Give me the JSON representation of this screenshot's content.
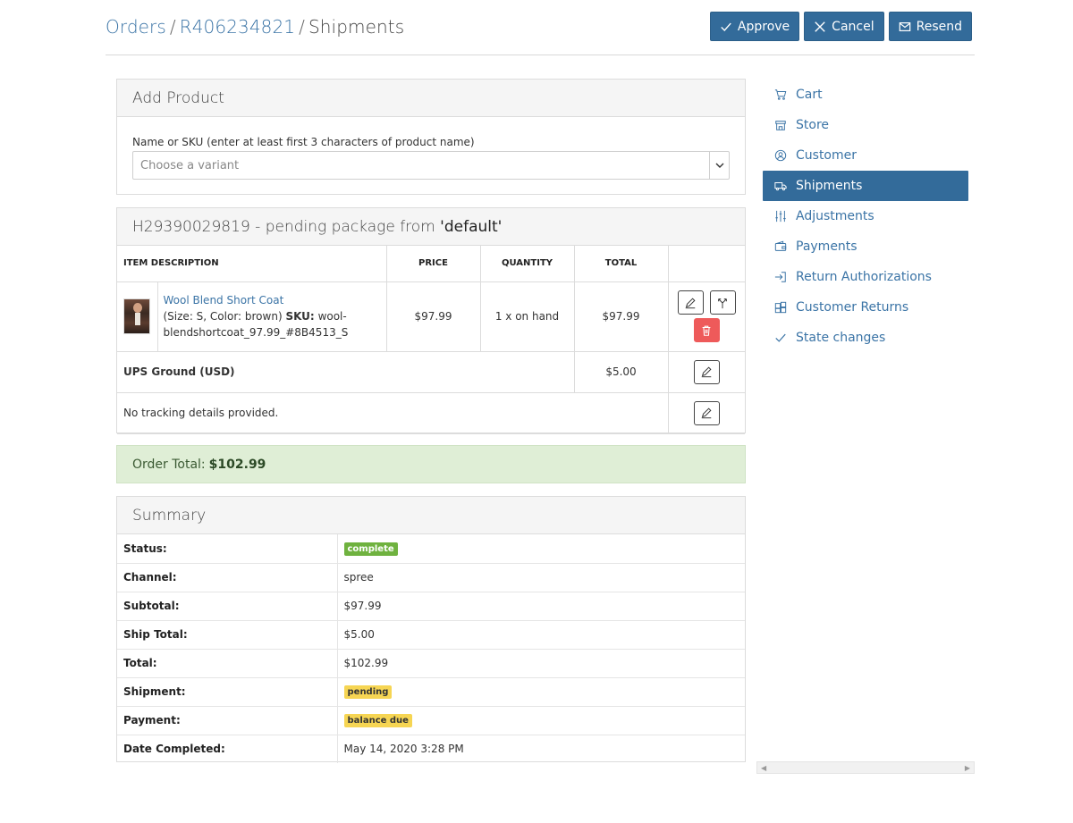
{
  "header": {
    "crumb_orders": "Orders",
    "crumb_order": "R406234821",
    "crumb_current": "Shipments",
    "separator": "/",
    "approve": "Approve",
    "cancel": "Cancel",
    "resend": "Resend"
  },
  "add_product": {
    "title": "Add Product",
    "label": "Name or SKU (enter at least first 3 characters of product name)",
    "placeholder": "Choose a variant"
  },
  "shipment": {
    "title_prefix": "H29390029819 - pending package from",
    "title_stock": "'default'",
    "columns": [
      "Item Description",
      "Price",
      "Quantity",
      "Total"
    ],
    "item": {
      "name": "Wool Blend Short Coat",
      "options": "(Size: S, Color: brown)",
      "sku_label": "SKU:",
      "sku": "wool-blendshortcoat_97.99_#8B4513_S",
      "price": "$97.99",
      "quantity": "1 x on hand",
      "total": "$97.99"
    },
    "shipping_method": "UPS Ground (USD)",
    "shipping_cost": "$5.00",
    "tracking": "No tracking details provided."
  },
  "order_total": {
    "label": "Order Total:",
    "value": "$102.99"
  },
  "summary": {
    "title": "Summary",
    "rows": [
      {
        "label": "Status:",
        "value": "complete"
      },
      {
        "label": "Channel:",
        "value": "spree"
      },
      {
        "label": "Subtotal:",
        "value": "$97.99"
      },
      {
        "label": "Ship Total:",
        "value": "$5.00"
      },
      {
        "label": "Total:",
        "value": "$102.99"
      },
      {
        "label": "Shipment:",
        "value": "pending"
      },
      {
        "label": "Payment:",
        "value": "balance due"
      },
      {
        "label": "Date Completed:",
        "value": "May 14, 2020 3:28 PM"
      }
    ]
  },
  "sidebar": {
    "items": [
      {
        "label": "Cart",
        "icon": "cart-icon"
      },
      {
        "label": "Store",
        "icon": "store-icon"
      },
      {
        "label": "Customer",
        "icon": "user-circle-icon"
      },
      {
        "label": "Shipments",
        "icon": "truck-icon",
        "active": true
      },
      {
        "label": "Adjustments",
        "icon": "sliders-icon"
      },
      {
        "label": "Payments",
        "icon": "wallet-icon"
      },
      {
        "label": "Return Authorizations",
        "icon": "return-icon"
      },
      {
        "label": "Customer Returns",
        "icon": "returns-box-icon"
      },
      {
        "label": "State changes",
        "icon": "check-icon"
      }
    ]
  },
  "colors": {
    "primary": "#336b9a",
    "link": "#3b74a6",
    "success_bg": "#dfeed6",
    "badge_complete": "#6fb23f",
    "badge_warning": "#f6d553",
    "danger": "#ee5a5a"
  }
}
